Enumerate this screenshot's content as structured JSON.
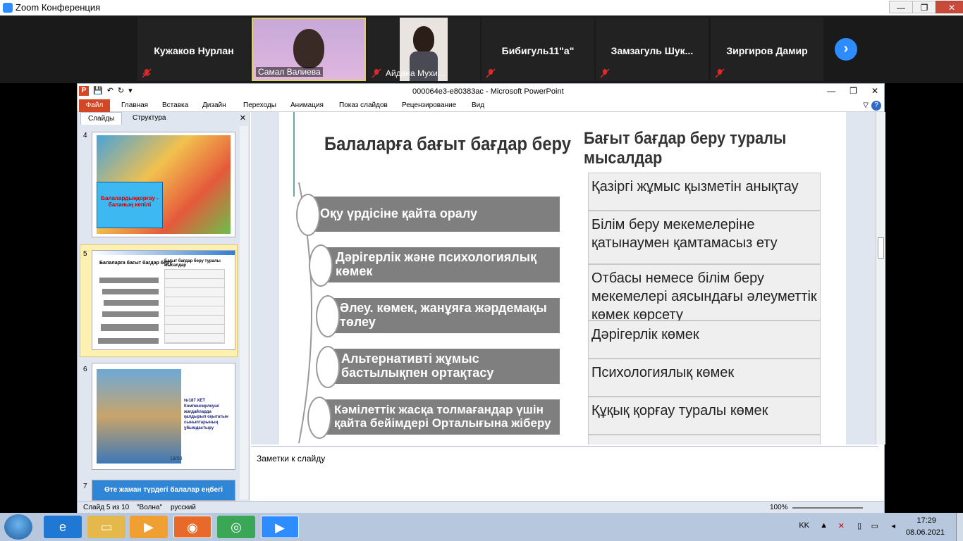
{
  "zoom": {
    "title": "Zoom Конференция",
    "participants": [
      {
        "name": "Кужаков Нурлан"
      },
      {
        "label": "Самал Валиева"
      },
      {
        "label": "Айдана Мухи..."
      },
      {
        "name": "Бибигуль11\"а\""
      },
      {
        "name": "Замзагуль  Шук..."
      },
      {
        "name": "Зиргиров Дамир"
      }
    ],
    "next_icon": "›",
    "minimize": "—",
    "maximize": "❐",
    "close": "✕"
  },
  "ppt": {
    "title": "000064e3-e80383ac  -  Microsoft PowerPoint",
    "tabs": [
      "Файл",
      "Главная",
      "Вставка",
      "Дизайн",
      "Переходы",
      "Анимация",
      "Показ слайдов",
      "Рецензирование",
      "Вид"
    ],
    "pane_tabs": [
      "Слайды",
      "Структура"
    ],
    "slide_numbers": [
      "4",
      "5",
      "6",
      "7"
    ],
    "thumb4_text": "Балалардыңқорғау - баланың кепілі",
    "thumb5_title": "Балаларға бағыт бағдар беру",
    "thumb5_subtitle": "Бағыт бағдар беру туралы мысалдар",
    "thumb6_text": "№187 ХЕТ Компенсирлеуші жағдайларда қалдырып оқытатын сыныптарының ұйымдастыру",
    "thumb6_date": "19/03",
    "thumb7_text": "Өте жаман түрдегі балалар  еңбегі",
    "notes_placeholder": "Заметки к слайду",
    "status": {
      "slide": "Слайд 5 из 10",
      "theme": "\"Волна\"",
      "lang": "русский",
      "zoom": "100%"
    }
  },
  "slide": {
    "left_title": "Балаларға бағыт бағдар беру",
    "right_title": "Бағыт бағдар беру туралы мысалдар",
    "left_items": [
      "Оқу үрдісіне қайта оралу",
      "Дәрігерлік және психологиялық  көмек",
      "Әлеу. көмек, жанұяға жәрдемақы төлеу",
      "Альтернативті жұмыс бастылықпен ортақтасу",
      "Кәмілеттік жасқа толмағандар үшін қайта бейімдері  Орталығына жіберу"
    ],
    "right_items": [
      "Қазіргі жұмыс қызметін анықтау",
      "Білім беру мекемелеріне қатынаумен қамтамасыз ету",
      "Отбасы немесе білім беру мекемелері аясындағы әлеуметтік көмек көрсету",
      "Дәрігерлік көмек",
      "Психологиялық көмек",
      "Құқық қорғау туралы көмек"
    ]
  },
  "taskbar": {
    "lang": "KK",
    "time": "17:29",
    "date": "08.06.2021"
  },
  "colors": {
    "accent": "#d24726",
    "zoom_blue": "#2d8cff",
    "bar_gray": "#7f7f7f"
  }
}
